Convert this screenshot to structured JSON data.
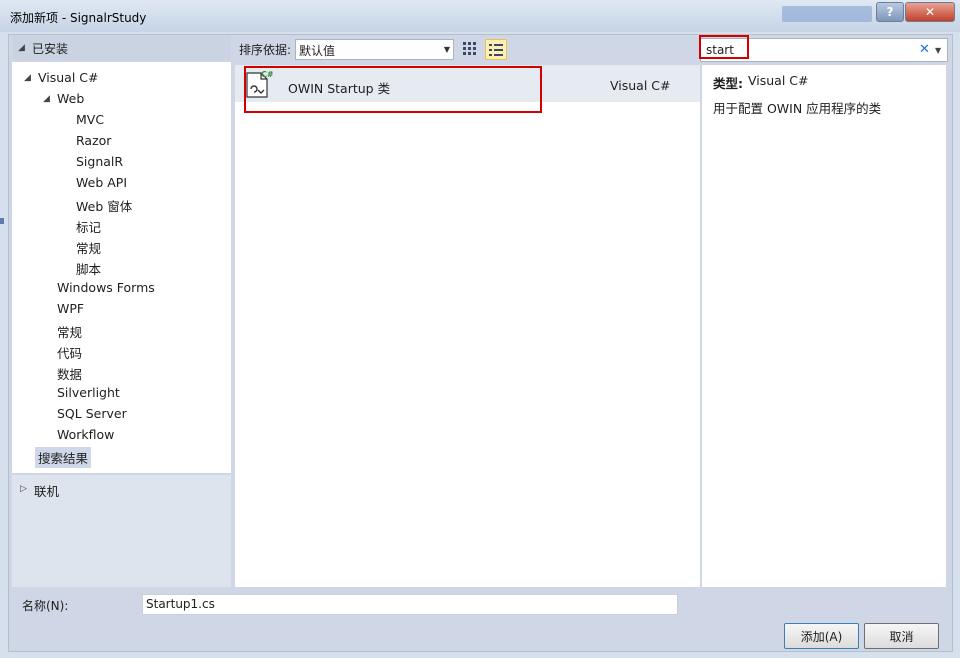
{
  "window": {
    "title": "添加新项 - SignalrStudy",
    "help_label": "?",
    "close_label": "✕"
  },
  "left": {
    "header": "已安装",
    "tree": [
      "Visual C#",
      "Web",
      "MVC",
      "Razor",
      "SignalR",
      "Web API",
      "Web 窗体",
      "标记",
      "常规",
      "脚本",
      "Windows Forms",
      "WPF",
      "常规",
      "代码",
      "数据",
      "Silverlight",
      "SQL Server",
      "Workflow",
      "搜索结果"
    ],
    "online": "联机"
  },
  "toolbar": {
    "sort_label": "排序依据:",
    "sort_value": "默认值"
  },
  "search": {
    "value": "start"
  },
  "results": [
    {
      "name": "OWIN Startup 类",
      "lang": "Visual C#"
    }
  ],
  "details": {
    "type_key": "类型:",
    "type_value": "Visual C#",
    "description": "用于配置 OWIN 应用程序的类"
  },
  "bottom": {
    "name_label": "名称(N):",
    "name_value": "Startup1.cs",
    "add_label": "添加(A)",
    "cancel_label": "取消"
  },
  "colors": {
    "highlight_red": "#d40000",
    "selected_row": "#e6ebf2",
    "panel_bg": "#cfd6e5"
  }
}
